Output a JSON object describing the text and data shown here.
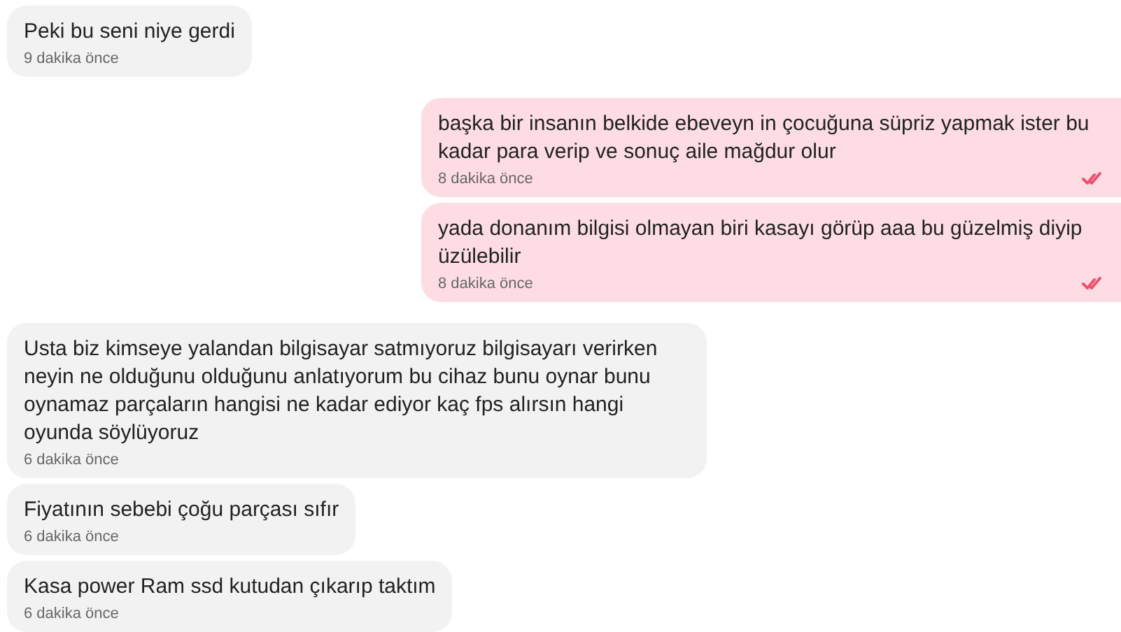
{
  "messages": [
    {
      "kind": "incoming",
      "text": "Peki bu seni niye gerdi",
      "time": "9 dakika önce"
    },
    {
      "kind": "outgoing",
      "text": "başka bir insanın belkide ebeveyn in çocuğuna süpriz yapmak ister bu kadar para verip ve sonuç aile mağdur olur",
      "time": "8 dakika önce",
      "read": true
    },
    {
      "kind": "outgoing",
      "text": "yada donanım bilgisi olmayan biri kasayı görüp aaa bu güzelmiş diyip üzülebilir",
      "time": "8 dakika önce",
      "read": true
    },
    {
      "kind": "incoming",
      "text": "Usta biz kimseye yalandan bilgisayar satmıyoruz bilgisayarı verirken neyin ne olduğunu olduğunu anlatıyorum bu cihaz bunu oynar bunu oynamaz parçaların hangisi ne kadar ediyor kaç fps alırsın hangi oyunda söylüyoruz",
      "time": "6 dakika önce"
    },
    {
      "kind": "incoming",
      "text": "Fiyatının sebebi çoğu parçası sıfır",
      "time": "6 dakika önce"
    },
    {
      "kind": "incoming",
      "text": "Kasa power Ram ssd kutudan çıkarıp taktım",
      "time": "6 dakika önce"
    }
  ]
}
